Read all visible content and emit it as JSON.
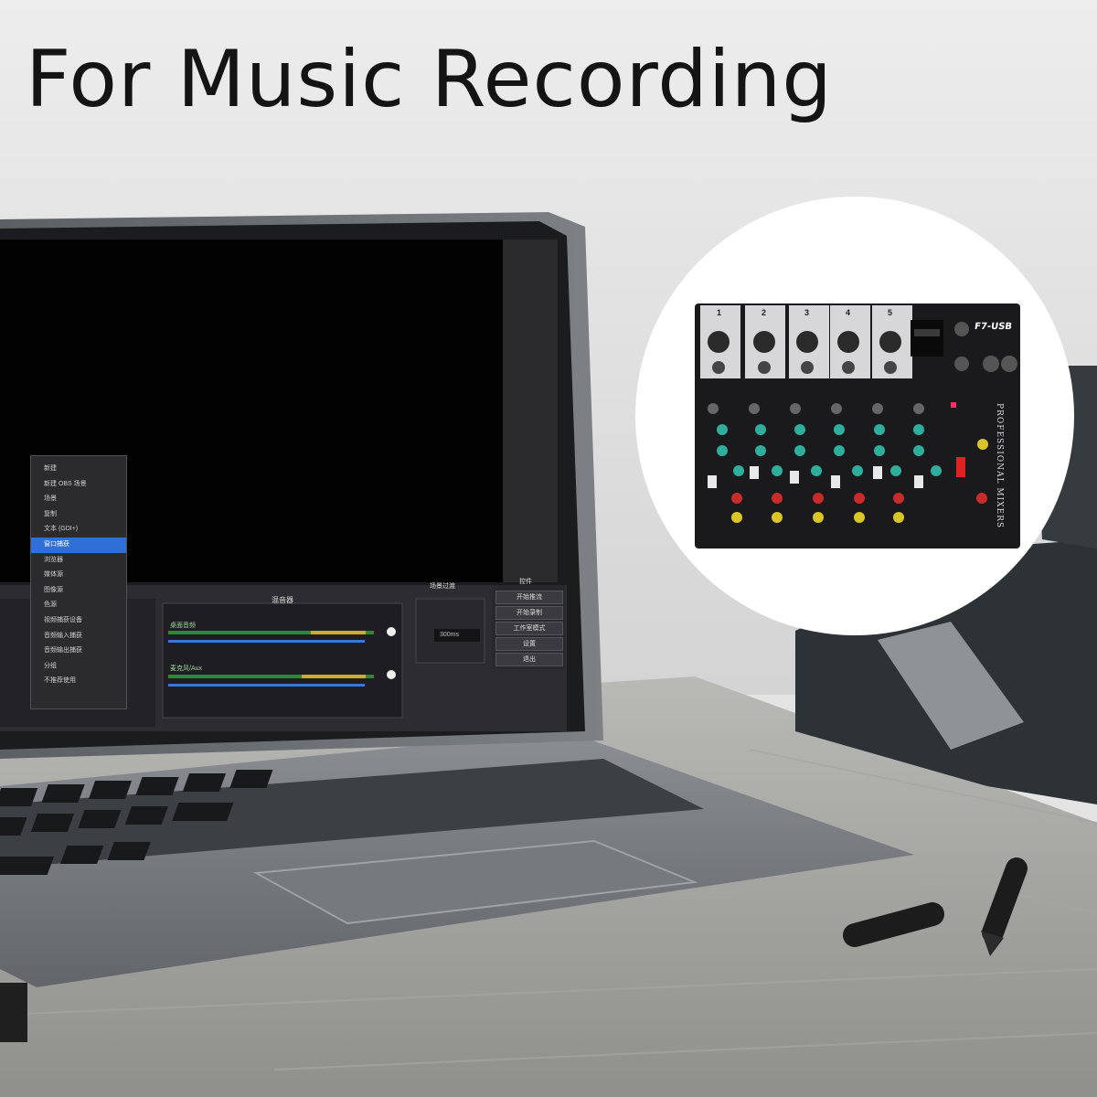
{
  "headline": "For Music Recording",
  "screen": {
    "context_menu": {
      "items": [
        {
          "label": "新建",
          "active": false
        },
        {
          "label": "新建 OBS 场景",
          "active": false
        },
        {
          "label": "场景",
          "active": false
        },
        {
          "label": "复制",
          "active": false
        },
        {
          "label": "文本 (GDI+)",
          "active": false
        },
        {
          "label": "窗口捕获",
          "active": true
        },
        {
          "label": "浏览器",
          "active": false
        },
        {
          "label": "媒体源",
          "active": false
        },
        {
          "label": "图像源",
          "active": false
        },
        {
          "label": "色源",
          "active": false
        },
        {
          "label": "视频捕获设备",
          "active": false
        },
        {
          "label": "音频输入捕获",
          "active": false
        },
        {
          "label": "音频输出捕获",
          "active": false
        },
        {
          "label": "分组",
          "active": false
        },
        {
          "label": "不推荐使用",
          "active": false
        }
      ]
    },
    "mixer_panel": {
      "title": "混音器",
      "channels": [
        {
          "label": "桌面音频"
        },
        {
          "label": "麦克风/Aux"
        }
      ]
    },
    "transition_panel": {
      "title": "场景过渡",
      "duration": "300ms"
    },
    "controls": {
      "title": "控件",
      "buttons": [
        "开始推流",
        "开始录制",
        "工作室模式",
        "设置",
        "退出"
      ]
    }
  },
  "mixer_device": {
    "model": "F7-USB",
    "brand_text": "PROFESSIONAL MIXERS",
    "channel_numbers": [
      "1",
      "2",
      "3",
      "4",
      "5"
    ]
  }
}
